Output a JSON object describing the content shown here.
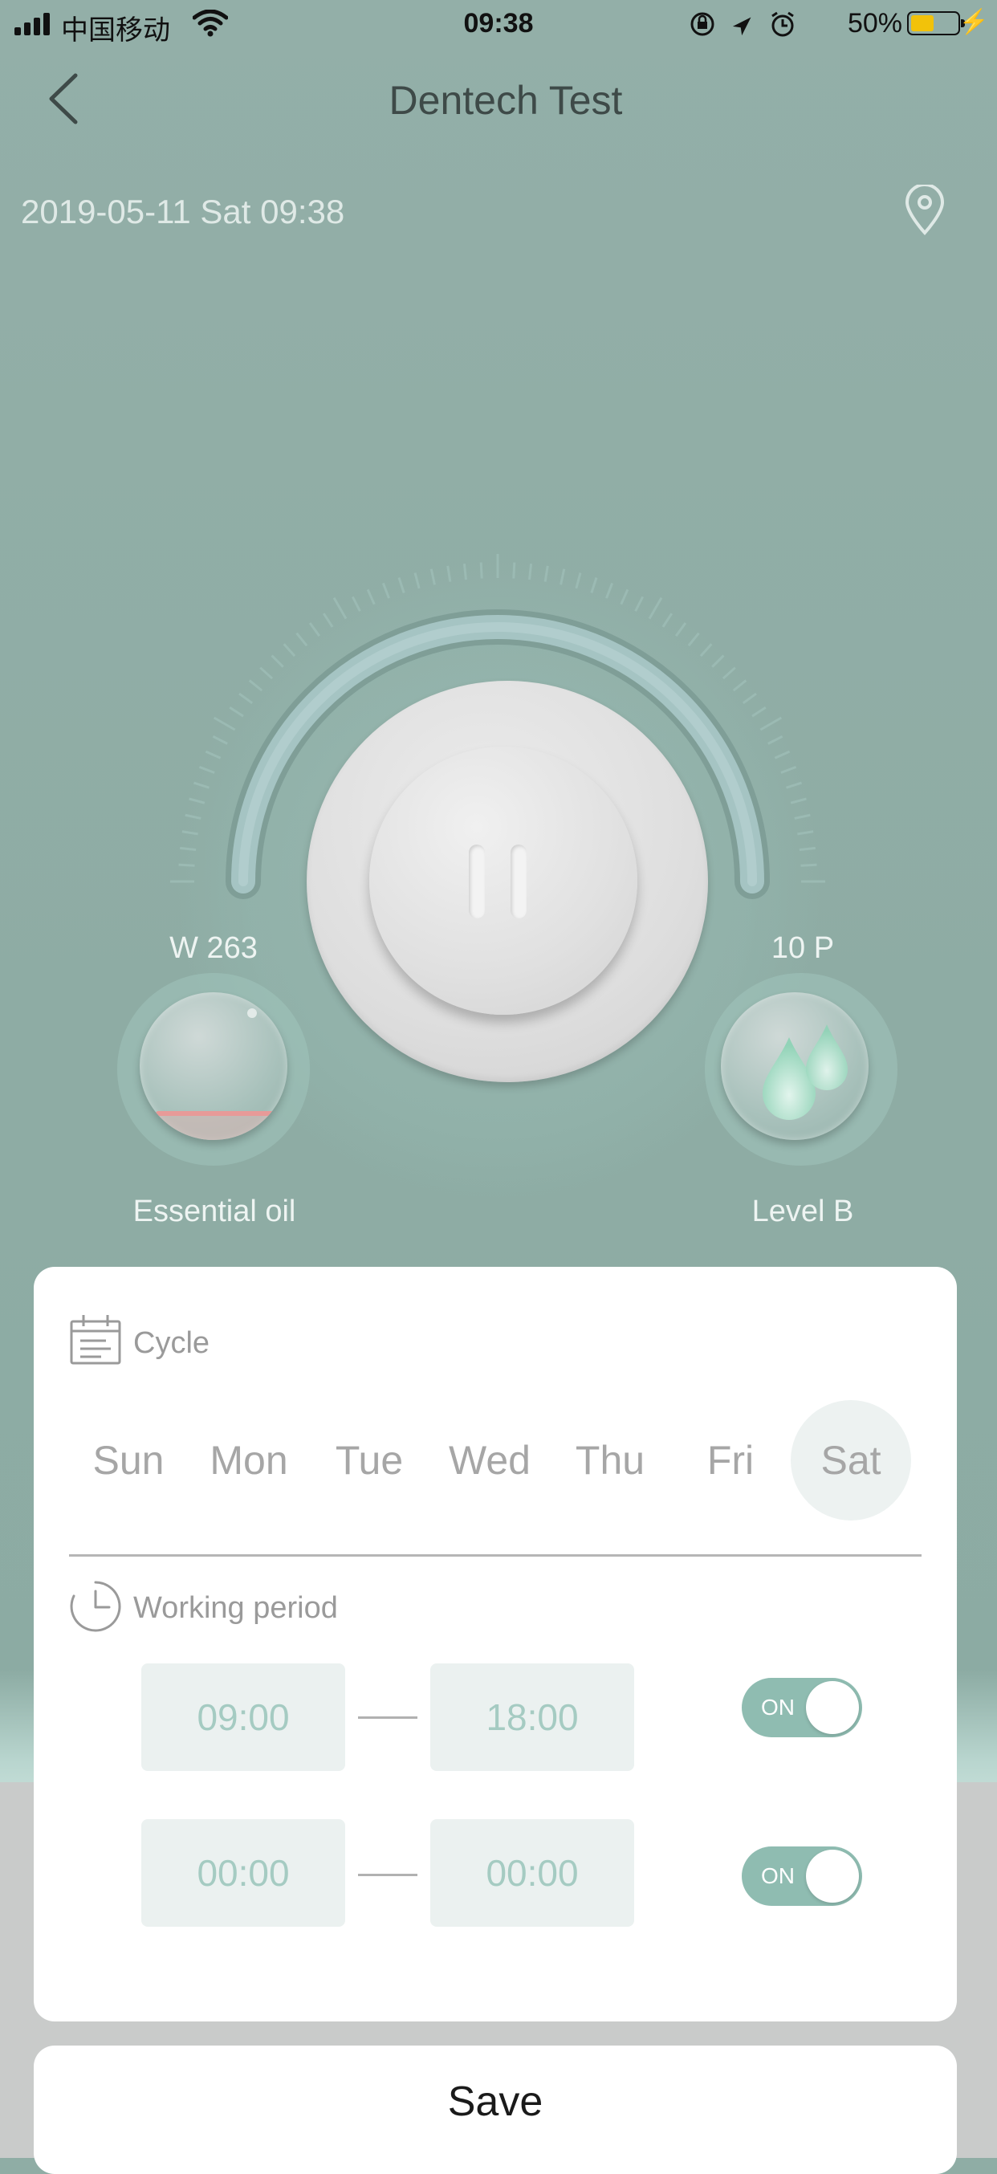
{
  "status_bar": {
    "carrier": "中国移动",
    "time": "09:38",
    "battery": "50%"
  },
  "header": {
    "title": "Dentech Test"
  },
  "info": {
    "datetime": "2019-05-11 Sat 09:38"
  },
  "device": {
    "left_value": "W 263",
    "left_caption": "Essential oil",
    "right_value": "10 P",
    "right_caption": "Level B"
  },
  "cycle": {
    "label": "Cycle",
    "days": [
      "Sun",
      "Mon",
      "Tue",
      "Wed",
      "Thu",
      "Fri",
      "Sat"
    ],
    "selected": [
      "Sat"
    ]
  },
  "working_period": {
    "label": "Working period",
    "periods": [
      {
        "start": "09:00",
        "end": "18:00",
        "toggle": "ON"
      },
      {
        "start": "00:00",
        "end": "00:00",
        "toggle": "ON"
      }
    ]
  },
  "save_button": {
    "label": "Save"
  },
  "colors": {
    "background": "#8fada5",
    "accent": "#8fbcb1",
    "time_text": "#a5cbc2",
    "time_box": "#ebf1f0"
  }
}
